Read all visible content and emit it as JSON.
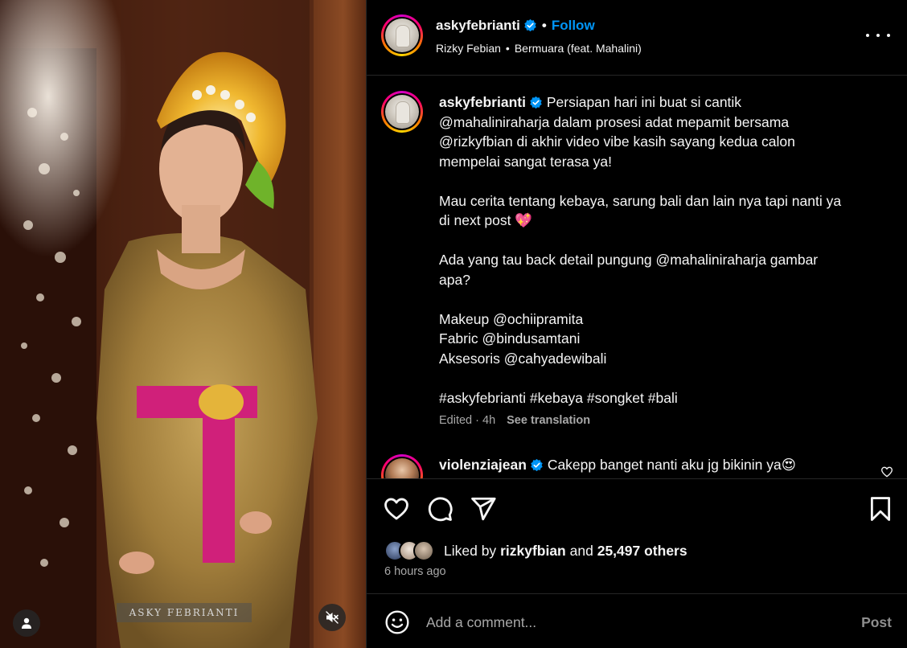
{
  "media": {
    "watermark": "ASKY FEBRIANTI",
    "tag_icon": "user-tag-icon",
    "mute_icon": "speaker-muted-icon"
  },
  "header": {
    "username": "askyfebrianti",
    "follow_label": "Follow",
    "audio_artist": "Rizky Febian",
    "audio_track": "Bermuara (feat. Mahalini)",
    "more_icon": "more-options-icon"
  },
  "caption": {
    "username": "askyfebrianti",
    "line1": "Persiapan hari ini buat si cantik",
    "line2": "@mahaliniraharja dalam prosesi adat mepamit bersama",
    "line3": "@rizkyfbian di akhir video vibe kasih sayang kedua calon",
    "line4": "mempelai sangat terasa ya!",
    "para2_line1": "Mau cerita tentang kebaya, sarung bali dan lain nya tapi nanti ya",
    "para2_line2": "di next post 💖",
    "para3_line1": "Ada yang tau back detail pungung @mahaliniraharja gambar",
    "para3_line2": "apa?",
    "credit_makeup": "Makeup @ochiipramita",
    "credit_fabric": "Fabric @bindusamtani",
    "credit_accessories": "Aksesoris @cahyadewibali",
    "hashtags": "#askyfebrianti #kebaya #songket #bali",
    "edited": "Edited · 4h",
    "see_translation": "See translation"
  },
  "comment": {
    "username": "violenziajean",
    "text": "Cakepp banget nanti aku jg bikinin ya😍"
  },
  "actions": {
    "like_icon": "heart-icon",
    "comment_icon": "comment-icon",
    "share_icon": "share-icon",
    "save_icon": "bookmark-icon",
    "liked_by_prefix": "Liked by",
    "liked_by_user": "rizkyfbian",
    "liked_by_and": "and",
    "others": "25,497 others",
    "time_ago": "6 hours ago"
  },
  "add_comment": {
    "placeholder": "Add a comment...",
    "post_label": "Post",
    "emoji_icon": "emoji-icon"
  },
  "colors": {
    "follow_blue": "#0095f6",
    "verified_blue": "#0095f6",
    "secondary_text": "#a8a8a8"
  }
}
